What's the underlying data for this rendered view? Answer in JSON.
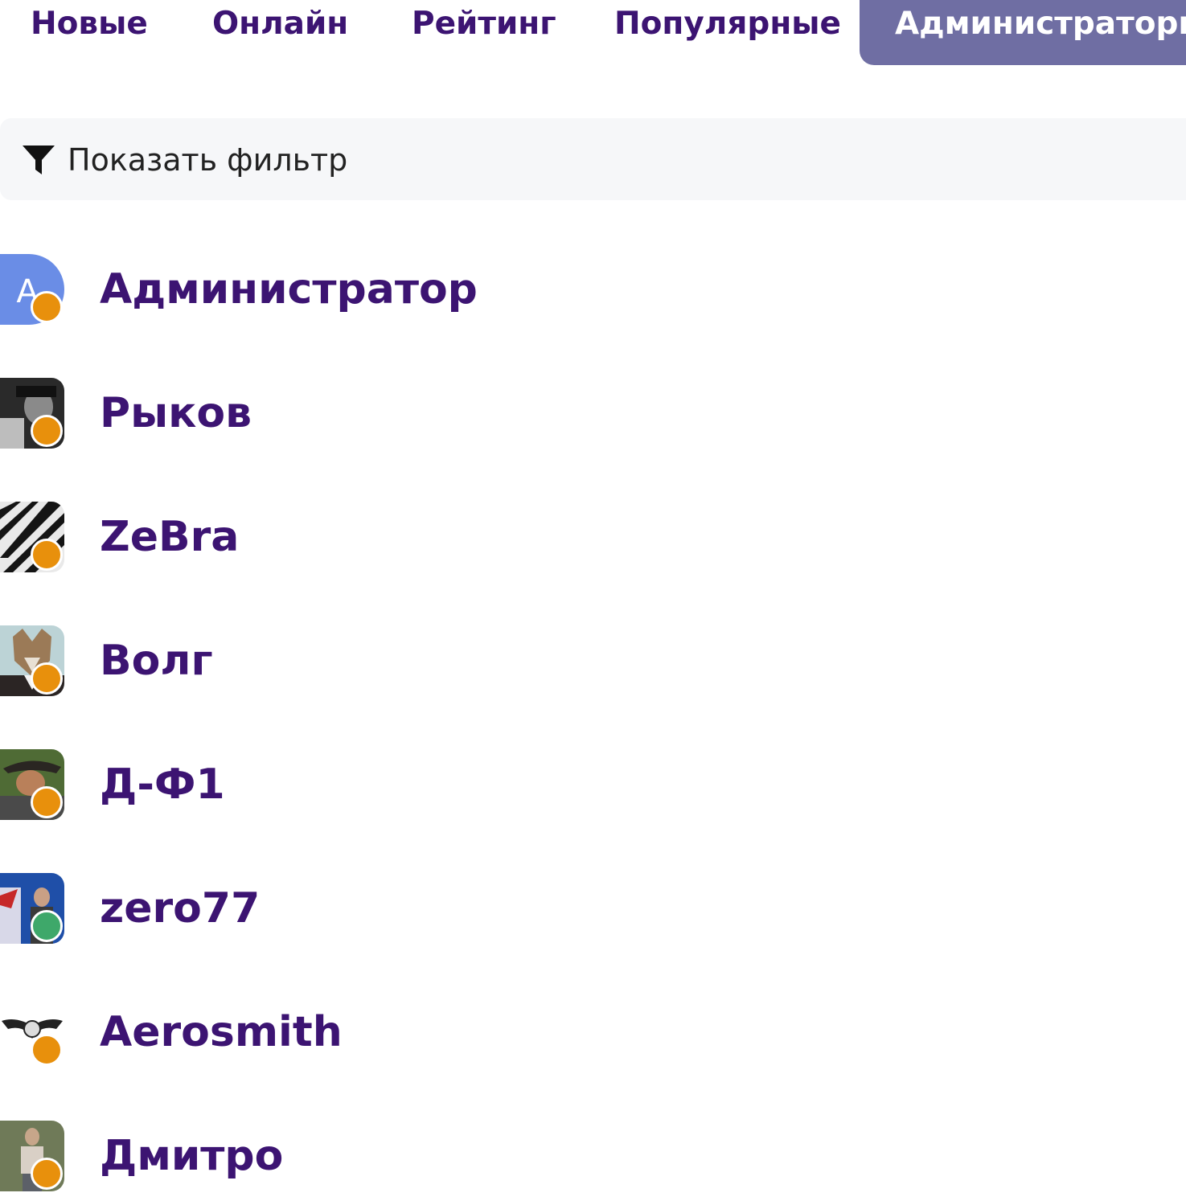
{
  "tabs": [
    {
      "label": "Новые"
    },
    {
      "label": "Онлайн"
    },
    {
      "label": "Рейтинг"
    },
    {
      "label": "Популярные"
    },
    {
      "label": "Администраторы",
      "active": true
    }
  ],
  "filter": {
    "label": "Показать фильтр",
    "icon": "filter-icon"
  },
  "colors": {
    "accent": "#6f6ea3",
    "link": "#3c1472",
    "status_away": "#e8900c",
    "status_online": "#3ea86a"
  },
  "users": [
    {
      "name": "Администратор",
      "avatar_letter": "А",
      "status": "away"
    },
    {
      "name": "Рыков",
      "status": "away"
    },
    {
      "name": "ZeBra",
      "status": "away"
    },
    {
      "name": "Волг",
      "status": "away"
    },
    {
      "name": "Д-Ф1",
      "status": "away"
    },
    {
      "name": "zero77",
      "status": "online"
    },
    {
      "name": "Aerosmith",
      "status": "away"
    },
    {
      "name": "Дмитро",
      "status": "away"
    }
  ]
}
